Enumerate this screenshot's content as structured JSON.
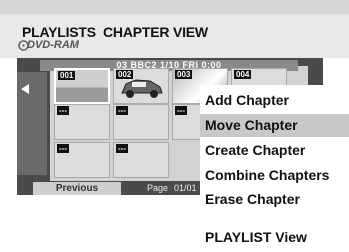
{
  "header": {
    "title": "PLAYLISTS",
    "view": "CHAPTER VIEW",
    "media": "DVD-RAM"
  },
  "info_bar": "03 BBC2 1/10 FRI 0:00",
  "chapters": [
    {
      "label": "001"
    },
    {
      "label": "002"
    },
    {
      "label": "003"
    },
    {
      "label": "004"
    },
    {
      "label": "---"
    },
    {
      "label": "---"
    },
    {
      "label": "---"
    },
    {
      "label": "---"
    },
    {
      "label": "---"
    }
  ],
  "footer": {
    "previous": "Previous",
    "page_label": "Page",
    "page": "01/01"
  },
  "menu": {
    "items": [
      {
        "label": "Add Chapter"
      },
      {
        "label": "Move Chapter",
        "selected": true
      },
      {
        "label": "Create Chapter"
      },
      {
        "label": "Combine Chapters"
      },
      {
        "label": "Erase Chapter"
      },
      {
        "label": "PLAYLIST View"
      }
    ]
  }
}
